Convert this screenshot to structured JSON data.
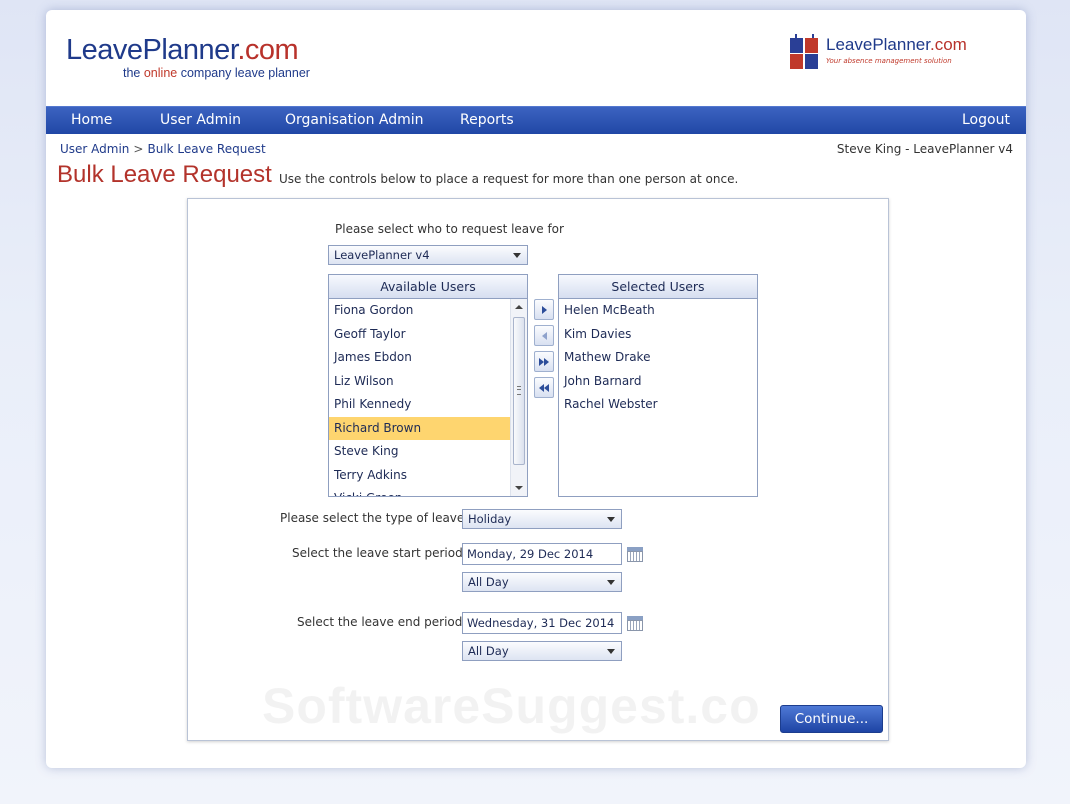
{
  "header": {
    "logo_left": {
      "name": "LeavePlanner",
      "dot": ".com",
      "tag_pre": "the ",
      "tag_hl": "online",
      "tag_post": " company leave planner"
    },
    "logo_right": {
      "name": "LeavePlanner",
      "dot": ".com",
      "tag": "Your absence management solution"
    }
  },
  "nav": {
    "home": "Home",
    "user_admin": "User Admin",
    "org_admin": "Organisation Admin",
    "reports": "Reports",
    "logout": "Logout"
  },
  "breadcrumb": {
    "parent": "User Admin",
    "separator": ">",
    "current": "Bulk Leave Request"
  },
  "user_info": "Steve King - LeavePlanner v4",
  "page": {
    "title": "Bulk Leave Request",
    "subtitle": "Use the controls below to place a request for more than one person at once."
  },
  "form": {
    "who_label": "Please select who to request leave for",
    "group_value": "LeavePlanner v4",
    "available_header": "Available Users",
    "available_users": [
      "Fiona Gordon",
      "Geoff Taylor",
      "James Ebdon",
      "Liz Wilson",
      "Phil Kennedy",
      "Richard Brown",
      "Steve King",
      "Terry Adkins",
      "Vicki Green"
    ],
    "selected_index": 5,
    "selected_header": "Selected Users",
    "selected_users": [
      "Helen McBeath",
      "Kim Davies",
      "Mathew Drake",
      "John Barnard",
      "Rachel Webster"
    ],
    "type_label": "Please select the type of leave",
    "type_value": "Holiday",
    "start_label": "Select the leave start period",
    "start_date": "Monday, 29 Dec 2014",
    "start_part": "All Day",
    "end_label": "Select the leave end period",
    "end_date": "Wednesday, 31 Dec 2014",
    "end_part": "All Day",
    "continue": "Continue..."
  },
  "watermark": "SoftwareSuggest.co"
}
